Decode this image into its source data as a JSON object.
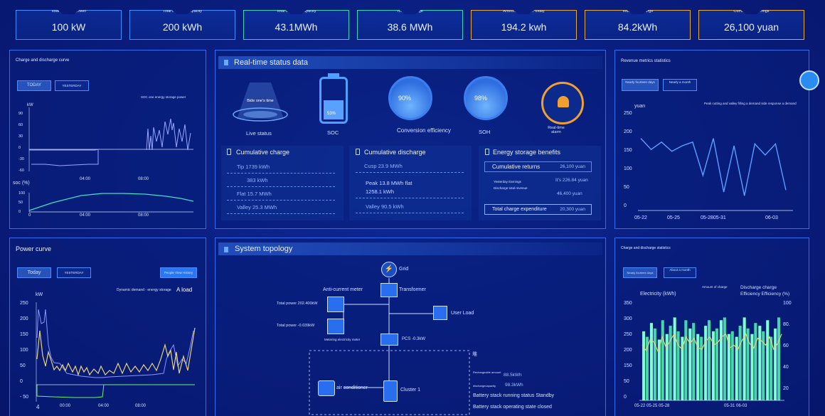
{
  "kpis": [
    {
      "label": "Total installed power",
      "value": "100 kW",
      "tone": "blue"
    },
    {
      "label": "Total installed capacity",
      "value": "200 kWh",
      "tone": "blue"
    },
    {
      "label": "Total charging capacity",
      "value": "43.1MWh",
      "tone": "green"
    },
    {
      "label": "Total discharge",
      "value": "38.6 MWh",
      "tone": "green"
    },
    {
      "label": "Amount of charge today",
      "value": "194.2 kwh",
      "tone": "orange"
    },
    {
      "label": "Today's discharge",
      "value": "84.2kWh",
      "tone": "orange"
    },
    {
      "label": "Cumulative earnings",
      "value": "26,100 yuan",
      "tone": "orange"
    }
  ],
  "charge_curve": {
    "title": "Charge and discharge curve",
    "btn_today": "TODAY",
    "btn_yesterday": "YESTERDAY",
    "legend": "SOC one energy storage power",
    "unit": "kW",
    "soc_label": "soc (%)",
    "y_ticks": [
      "90",
      "60",
      "30",
      "0",
      "-30",
      "-60"
    ],
    "soc_ticks": [
      "100",
      "50",
      "0"
    ],
    "x_ticks": [
      "4",
      "04:00",
      "08:00"
    ],
    "x_ticks2": [
      "0",
      "04:00",
      "08:00"
    ]
  },
  "realtime": {
    "title": "Real-time status data",
    "live_text": "Bide one's time",
    "live_label": "Live status",
    "soc_pct": "53%",
    "soc_label": "SOC",
    "conv_pct": "90%",
    "conv_label": "Conversion efficiency",
    "soh_pct": "98%",
    "soh_label": "SOH",
    "alarm_label": "Real-time alarm",
    "cum_charge": {
      "title": "Cumulative charge",
      "rows": [
        "Tip 1739 kWh",
        "383 kWh",
        "Flat 15.7 MWh",
        "Valley 25.3 MWh"
      ]
    },
    "cum_discharge": {
      "title": "Cumulative discharge",
      "rows": [
        "Cusp 23.9 MWh",
        "Peak 13.8 MWh flat",
        "1258.1 kWh",
        "Valley 90.5 kWh"
      ]
    },
    "benefits": {
      "title": "Energy storage benefits",
      "cum_returns": "Cumulative returns",
      "cum_returns_v": "26,100 yuan",
      "yesterday": "Yesterday Earnings",
      "yesterday_v": "It's 226.84 yuan",
      "discharge_total": "Discharge total revenue",
      "discharge_total_v": "46,400 yuan",
      "charge_exp": "Total charge expenditure",
      "charge_exp_v": "20,300 yuan"
    }
  },
  "revenue": {
    "title": "Revenue metrics statistics",
    "btn1": "Nearly fourteen days",
    "btn2": "Nearly a month",
    "unit": "yuan",
    "legend": "Peak cutting and valley filling a demand side response a demand",
    "y_ticks": [
      "250",
      "200",
      "150",
      "100",
      "50",
      "0"
    ],
    "x_ticks": [
      "05-22",
      "05-25",
      "05-2805-31",
      "06-03"
    ]
  },
  "power_curve": {
    "title": "Power curve",
    "btn_today": "Today",
    "btn_yesterday": "YESTERDAY",
    "btn_history": "People View History",
    "legend": "Dynamic demand - energy storage",
    "legend2": "A load",
    "unit": "kW",
    "y_ticks": [
      "250",
      "200",
      "150",
      "100",
      "50",
      "0",
      "- 50"
    ],
    "x_ticks": [
      "4",
      "00:00",
      "04:00",
      "08:00"
    ]
  },
  "topology": {
    "title": "System topology",
    "grid": "Grid",
    "transformer": "Transformer",
    "anti_meter": "Anti-current meter",
    "user_load": "User Load",
    "total_power1": "Total power 202.400kW",
    "total_power2": "Total power -0.039kW",
    "metering": "Metering electricity meter",
    "pcs": "PCS -0.3kW",
    "side_char": "堆",
    "air": "air conditioner",
    "cluster": "Cluster 1",
    "rech_label": "Rechargeable amount",
    "rech_val": "88.5kWh",
    "disch_label": "dischargecapacity",
    "disch_val": "98.3kWh",
    "status1": "Battery stack running status Standby",
    "status2": "Battery stack operating state closed"
  },
  "stats": {
    "title": "Charge and discharge statistics",
    "btn1": "Nearly fourteen days",
    "btn2": "About a month",
    "legend1": "Amount of charge",
    "legend2": "Discharge charge",
    "legend3": "Efficiency Efficiency (%)",
    "ylabel": "Electricity (kWh)",
    "y_ticks": [
      "350",
      "300",
      "250",
      "200",
      "150",
      "50",
      "0"
    ],
    "y2_ticks": [
      "100",
      "80.",
      "60",
      "40",
      "20"
    ],
    "x_ticks": [
      "05-22 05-25 05-28",
      "05-31 06-03"
    ]
  },
  "chart_data": [
    {
      "type": "line",
      "title": "Revenue metrics statistics",
      "x": [
        "05-22",
        "05-23",
        "05-24",
        "05-25",
        "05-26",
        "05-27",
        "05-28",
        "05-29",
        "05-30",
        "05-31",
        "06-01",
        "06-02",
        "06-03",
        "06-04",
        "06-05"
      ],
      "series": [
        {
          "values": [
            195,
            165,
            185,
            160,
            175,
            185,
            95,
            195,
            50,
            175,
            40,
            180,
            150,
            180,
            55
          ]
        }
      ],
      "ylim": [
        0,
        250
      ]
    },
    {
      "type": "bar",
      "title": "Charge and discharge statistics",
      "values": [
        250,
        230,
        280,
        260,
        220,
        290,
        240,
        270,
        300,
        250,
        230,
        290,
        260,
        280,
        240,
        230,
        270,
        290,
        250,
        260,
        290,
        300,
        240,
        250,
        230,
        270,
        300,
        260,
        240,
        280,
        270,
        250,
        290,
        230,
        260,
        300
      ],
      "series2": [
        200,
        180,
        220,
        210,
        175,
        230,
        190,
        215,
        240,
        200,
        185,
        230,
        205,
        225,
        190,
        185,
        215,
        230,
        200,
        210,
        230,
        240,
        190,
        200,
        185,
        215,
        240,
        205,
        190,
        225,
        215,
        200,
        230,
        185,
        205,
        240
      ],
      "ylim": [
        0,
        350
      ]
    }
  ]
}
